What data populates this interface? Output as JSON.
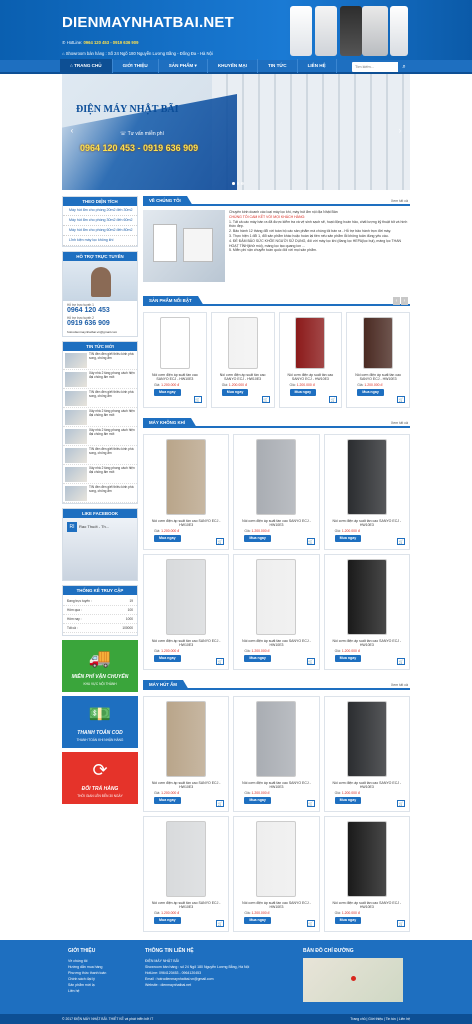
{
  "header": {
    "logo": "DIENMAYNHATBAI.NET",
    "hotline_label": "HotLine:",
    "hotline_numbers": "0964 120 453 - 0919 636 909",
    "showroom": "Showroom bán hàng : Số 24 Ngõ 180 Nguyễn Lương Bằng - Đống Đa - Hà Nội"
  },
  "nav": {
    "items": [
      "TRANG CHỦ",
      "GIỚI THIỆU",
      "SẢN PHẨM ▾",
      "KHUYẾN MẠI",
      "TIN TỨC",
      "LIÊN HỆ"
    ],
    "search_placeholder": "Tìm kiếm..."
  },
  "banner": {
    "title": "ĐIỆN MÁY NHẬT BÃI",
    "subtitle": "Tư vấn miễn phí",
    "phones": "0964 120 453 - 0919 636 909"
  },
  "sidebar": {
    "area_title": "THEO DIỆN TÍCH",
    "area_items": [
      "Máy hút ẩm cho phòng 20m2 đến 30m2",
      "Máy hút ẩm cho phòng 30m2 đến 60m2",
      "Máy hút ẩm cho phòng 60m2 đến 80m2",
      "Lĩnh kiện máy lọc không khí"
    ],
    "support_title": "HỖ TRỢ TRỰC TUYẾN",
    "support1_label": "Hỗ trợ trực tuyến 1",
    "support1_phone": "0964 120 453",
    "support2_label": "Hỗ trợ trực tuyến 2",
    "support2_phone": "0919 636 909",
    "support_email": "hotrodienmaynhatbai.vn@gmail.com",
    "news_title": "TIN TỨC MỚI",
    "news": [
      "TIN đèn đèn giết thiêu kính phá song, chống ẩm",
      "Xây nhà 2 tầng phong cách hiện đại chống ẩm mốt",
      "TIN đèn đèn giết thiêu kính phá song, chống ẩm",
      "Xây nhà 2 tầng phong cách hiện đại chống ẩm mốt",
      "Xây nhà 2 tầng phong cách hiện đại chống ẩm mốt",
      "TIN đèn đèn giết thiêu kính phá song, chống ẩm",
      "Xây nhà 2 tầng phong cách hiện đại chống ẩm mốt",
      "TIN đèn đèn giết thiêu kính phá song, chống ẩm"
    ],
    "facebook_title": "LIKE FACEBOOK",
    "facebook_page": "Rao Thuốt - Th...",
    "stats_title": "THỐNG KÊ TRUY CẬP",
    "stats": [
      {
        "label": "Đang trực tuyến :",
        "value": "19"
      },
      {
        "label": "Hôm qua :",
        "value": "100"
      },
      {
        "label": "Hôm nay :",
        "value": "1000"
      },
      {
        "label": "Tất cả :",
        "value": "100000"
      }
    ],
    "promos": [
      {
        "title": "MIỄN PHÍ VẬN CHUYỂN",
        "sub": "KHU VỰC NỘI THÀNH",
        "color": "#3aa53b"
      },
      {
        "title": "THANH TOÁN COD",
        "sub": "THANH TOÁN KHI NHẬN HÀNG",
        "color": "#1e6fc0"
      },
      {
        "title": "ĐỔI TRẢ HÀNG",
        "sub": "THỜI GIAN LÊN ĐẾN 30 NGÀY",
        "color": "#e5332a"
      }
    ]
  },
  "about": {
    "title": "VỀ CHÚNG TÔI",
    "more": "Xem tất cả",
    "intro": "Chuyên kinh doanh các loại máy lọc khí, máy hút ẩm nội địa Nhật Bản",
    "highlight": "CHÚNG TÔI CAM KẾT VỚI MỌI KHÁCH HÀNG:",
    "points": [
      "1. Tất cả các máy bán ra đã được kiểm tra và vệ sinh sạch sẽ, hoạt động hoàn hảo, chất lượng kỹ thuật tốt và hình thức đẹp.",
      "2. Bảo hành 12 tháng đổi với toàn bộ các sản phẩm mà chúng tôi bán ra - Hỗ trợ bảo hành trọn đời máy.",
      "3. Thực hiện 1 đổi 1, đổi sản phẩm khác hoặc hoàn lại tiền nếu sản phẩm lỗi không tuân đúng yêu cầu.",
      "4. ĐỂ ĐẢM BẢO SỨC KHỎE NGƯỜI SỬ DỤNG, đối với máy lọc khí (đang lọc HEPA(lọc bụi), màng lọc THAN HOẠT TÍNH(khử mùi), màng lọc tạo quang ion ...",
      "5. Miễn phí vận chuyển toàn quốc đối với mọi sản phẩm."
    ]
  },
  "featured": {
    "title": "SẢN PHẨM NỔI BẬT",
    "products": [
      {
        "name": "Nồi cơm điện áp suất tần cao SANYO ECJ - HW10E3",
        "price_label": "Giá:",
        "price": "1.200.000 đ",
        "buy": "Mua ngay",
        "color": "#ffffff"
      },
      {
        "name": "Nồi cơm điện áp suất tần cao SANYO ECJ - HW10E3",
        "price_label": "Giá:",
        "price": "1.200.000 đ",
        "buy": "Mua ngay",
        "color": "#f2f2f2"
      },
      {
        "name": "Nồi cơm điện áp suất tần cao SANYO ECJ - HW10E3",
        "price_label": "Giá:",
        "price": "1.200.000 đ",
        "buy": "Mua ngay",
        "color": "#8b1a1a"
      },
      {
        "name": "Nồi cơm điện áp suất tần cao SANYO ECJ - HW10E3",
        "price_label": "Giá:",
        "price": "1.200.000 đ",
        "buy": "Mua ngay",
        "color": "#4a2a22"
      }
    ]
  },
  "air_purifier": {
    "title": "MÁY KHÔNG KHÍ",
    "more": "Xem tất cả",
    "products": [
      {
        "name": "Nồi cơm điện áp suất tần cao SANYO ECJ - HW10E3",
        "price_label": "Giá:",
        "price": "1.200.000 đ",
        "buy": "Mua ngay",
        "color": "#b9a58a"
      },
      {
        "name": "Nồi cơm điện áp suất tần cao SANYO ECJ - HW10E3",
        "price_label": "Giá:",
        "price": "1.200.000 đ",
        "buy": "Mua ngay",
        "color": "#a9adb3"
      },
      {
        "name": "Nồi cơm điện áp suất tần cao SANYO ECJ - HW10E3",
        "price_label": "Giá:",
        "price": "1.200.000 đ",
        "buy": "Mua ngay",
        "color": "#2b2d30"
      },
      {
        "name": "Nồi cơm điện áp suất tần cao SANYO ECJ - HW10E3",
        "price_label": "Giá:",
        "price": "1.200.000 đ",
        "buy": "Mua ngay",
        "color": "#d8dadc"
      },
      {
        "name": "Nồi cơm điện áp suất tần cao SANYO ECJ - HW10E3",
        "price_label": "Giá:",
        "price": "1.200.000 đ",
        "buy": "Mua ngay",
        "color": "#eeeeee"
      },
      {
        "name": "Nồi cơm điện áp suất tần cao SANYO ECJ - HW10E3",
        "price_label": "Giá:",
        "price": "1.200.000 đ",
        "buy": "Mua ngay",
        "color": "#1a1a1a"
      }
    ]
  },
  "dehumidifier": {
    "title": "MÁY HÚT ẨM",
    "more": "Xem tất cả",
    "products": [
      {
        "name": "Nồi cơm điện áp suất tần cao SANYO ECJ - HW10E3",
        "price_label": "Giá:",
        "price": "1.200.000 đ",
        "buy": "Mua ngay",
        "color": "#b9a58a"
      },
      {
        "name": "Nồi cơm điện áp suất tần cao SANYO ECJ - HW10E3",
        "price_label": "Giá:",
        "price": "1.200.000 đ",
        "buy": "Mua ngay",
        "color": "#a9adb3"
      },
      {
        "name": "Nồi cơm điện áp suất tần cao SANYO ECJ - HW10E3",
        "price_label": "Giá:",
        "price": "1.200.000 đ",
        "buy": "Mua ngay",
        "color": "#2b2d30"
      },
      {
        "name": "Nồi cơm điện áp suất tần cao SANYO ECJ - HW10E3",
        "price_label": "Giá:",
        "price": "1.200.000 đ",
        "buy": "Mua ngay",
        "color": "#d8dadc"
      },
      {
        "name": "Nồi cơm điện áp suất tần cao SANYO ECJ - HW10E3",
        "price_label": "Giá:",
        "price": "1.200.000 đ",
        "buy": "Mua ngay",
        "color": "#eeeeee"
      },
      {
        "name": "Nồi cơm điện áp suất tần cao SANYO ECJ - HW10E3",
        "price_label": "Giá:",
        "price": "1.200.000 đ",
        "buy": "Mua ngay",
        "color": "#1a1a1a"
      }
    ]
  },
  "footer": {
    "intro_title": "GIỚI THIỆU",
    "intro_links": [
      "Về chúng tôi",
      "Hướng dẫn mua hàng",
      "Phương thức thanh toán",
      "Chính sách đại lý",
      "Sản phẩm mới lạ",
      "Liên hệ"
    ],
    "contact_title": "THÔNG TIN LIÊN HỆ",
    "contact_lines": [
      "ĐIỆN MÁY NHẬT BÃI",
      "Showroom bán hàng : số 24 Ngõ 180 Nguyễn Lương Bằng, Hà Nội",
      "HotLine: 0964120453 - 0964120453",
      "Email : hotrodienmaynhatbai.vn@gmail.com",
      "Website : dienmaynhatbai.net"
    ],
    "map_title": "BẢN ĐỒ CHỈ ĐƯỜNG",
    "copyright": "© 2017 ĐIỆN MÁY NHẬT BÃI. THIẾT KẾ và phát triển bởi IT",
    "bottom_links": "Trang chủ  |  Giới thiệu  |  Tin tức  |  Liên hệ"
  },
  "colors": {
    "primary": "#1e6fc0",
    "dark": "#0d4f94",
    "price": "#d8261d",
    "phone": "#d8261d"
  }
}
